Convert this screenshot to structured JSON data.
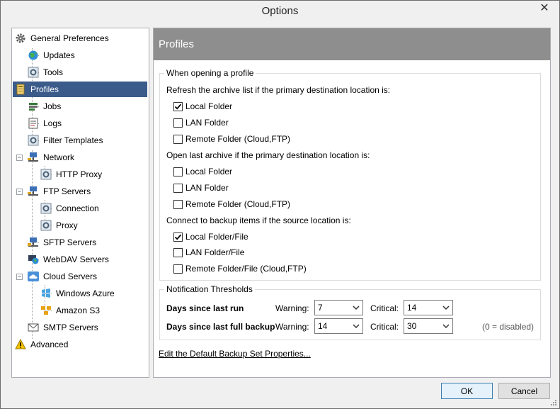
{
  "window": {
    "title": "Options",
    "close_glyph": "✕"
  },
  "tree": {
    "items": [
      {
        "label": "General Preferences",
        "icon": "gear-icon"
      },
      {
        "label": "Updates",
        "icon": "globe-icon"
      },
      {
        "label": "Tools",
        "icon": "tools-icon"
      },
      {
        "label": "Profiles",
        "icon": "profile-icon"
      },
      {
        "label": "Jobs",
        "icon": "jobs-icon"
      },
      {
        "label": "Logs",
        "icon": "log-icon"
      },
      {
        "label": "Filter Templates",
        "icon": "filter-icon"
      },
      {
        "label": "Network",
        "icon": "network-icon"
      },
      {
        "label": "HTTP Proxy",
        "icon": "proxy-icon"
      },
      {
        "label": "FTP Servers",
        "icon": "ftp-icon"
      },
      {
        "label": "Connection",
        "icon": "connection-icon"
      },
      {
        "label": "Proxy",
        "icon": "proxy-icon"
      },
      {
        "label": "SFTP Servers",
        "icon": "sftp-icon"
      },
      {
        "label": "WebDAV Servers",
        "icon": "webdav-icon"
      },
      {
        "label": "Cloud Servers",
        "icon": "cloud-icon"
      },
      {
        "label": "Windows Azure",
        "icon": "azure-icon"
      },
      {
        "label": "Amazon S3",
        "icon": "s3-icon"
      },
      {
        "label": "SMTP Servers",
        "icon": "mail-icon"
      },
      {
        "label": "Advanced",
        "icon": "warning-icon"
      }
    ],
    "selected": "Profiles"
  },
  "content": {
    "header": "Profiles",
    "opening": {
      "legend": "When opening a profile",
      "refresh_label": "Refresh the archive list if the primary destination location is:",
      "refresh_options": [
        {
          "label": "Local Folder",
          "checked": true
        },
        {
          "label": "LAN Folder",
          "checked": false
        },
        {
          "label": "Remote Folder (Cloud,FTP)",
          "checked": false
        }
      ],
      "open_label": "Open last archive if the primary destination location is:",
      "open_options": [
        {
          "label": "Local Folder",
          "checked": false
        },
        {
          "label": "LAN Folder",
          "checked": false
        },
        {
          "label": "Remote Folder (Cloud,FTP)",
          "checked": false
        }
      ],
      "connect_label": "Connect to backup items if the source location is:",
      "connect_options": [
        {
          "label": "Local Folder/File",
          "checked": true
        },
        {
          "label": "LAN Folder/File",
          "checked": false
        },
        {
          "label": "Remote Folder/File (Cloud,FTP)",
          "checked": false
        }
      ]
    },
    "thresholds": {
      "legend": "Notification Thresholds",
      "rows": [
        {
          "label": "Days since last run",
          "warning_label": "Warning:",
          "warning": "7",
          "critical_label": "Critical:",
          "critical": "14"
        },
        {
          "label": "Days since last full backup",
          "warning_label": "Warning:",
          "warning": "14",
          "critical_label": "Critical:",
          "critical": "30"
        }
      ],
      "hint": "(0 = disabled)"
    },
    "link": "Edit the Default Backup Set Properties..."
  },
  "buttons": {
    "ok": "OK",
    "cancel": "Cancel"
  }
}
